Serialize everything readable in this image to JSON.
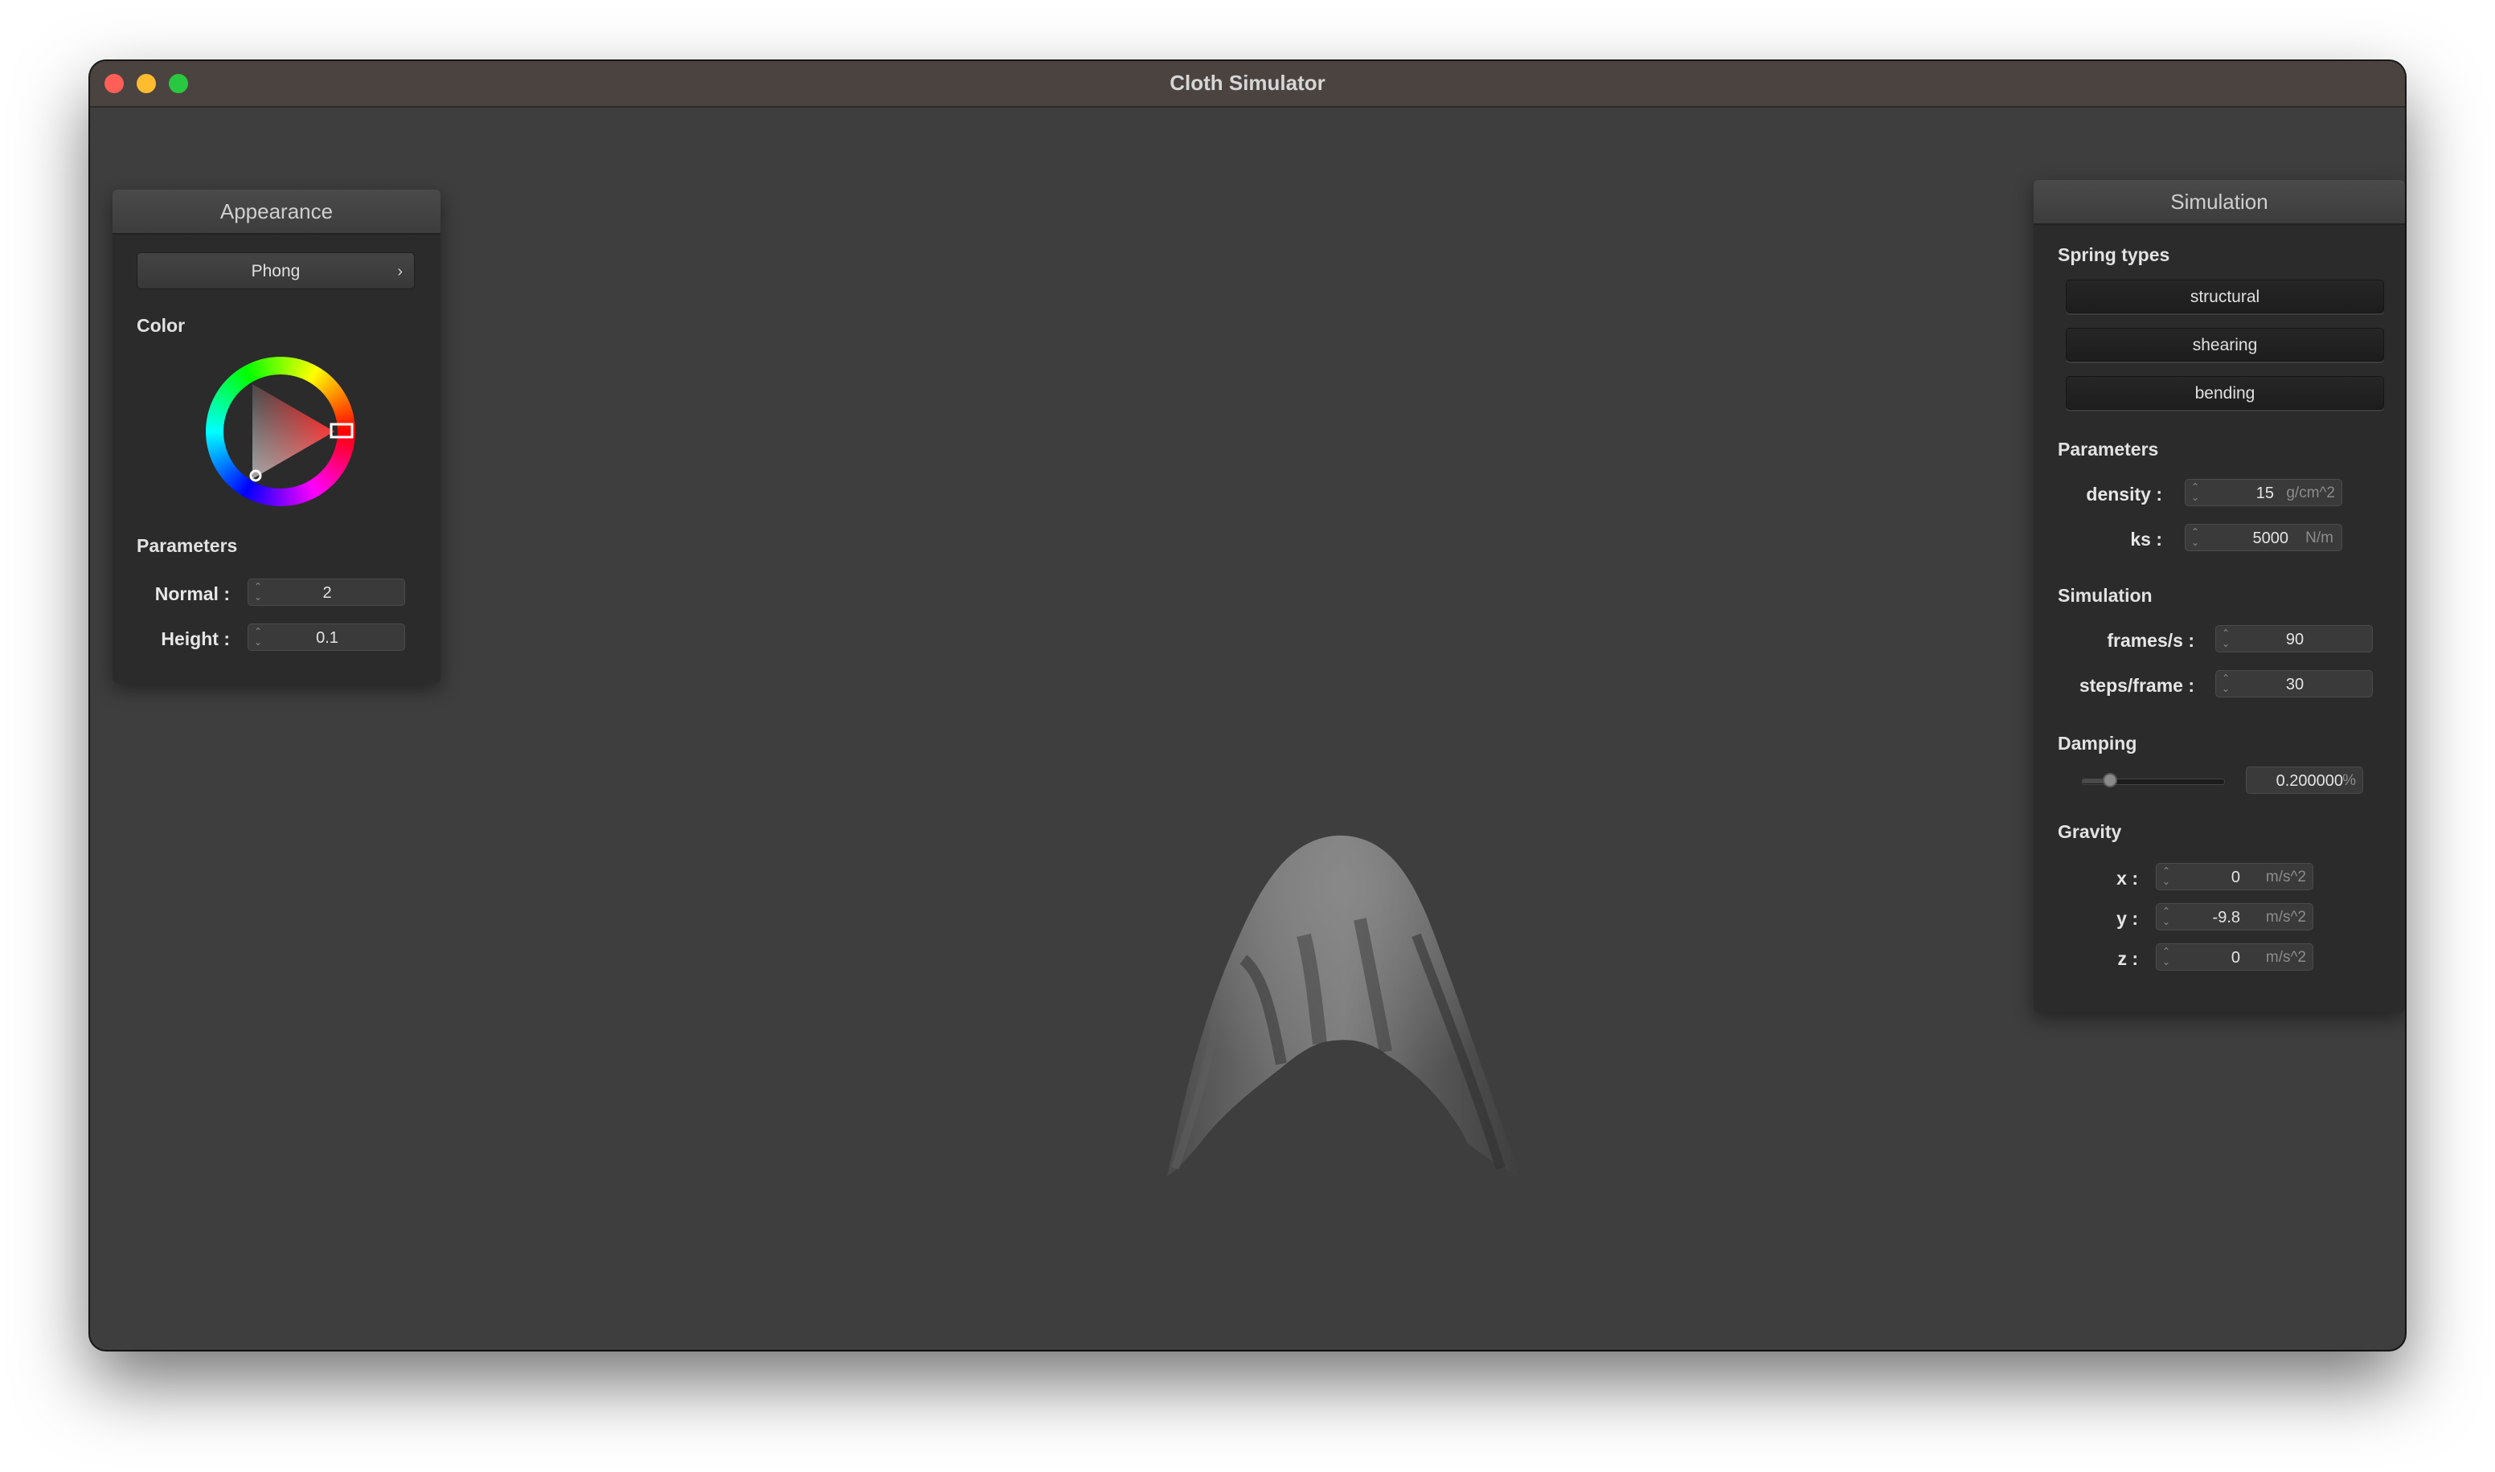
{
  "window": {
    "title": "Cloth Simulator",
    "traffic_lights": [
      "close",
      "minimize",
      "zoom"
    ]
  },
  "appearance": {
    "header": "Appearance",
    "shader_select": "Phong",
    "color_label": "Color",
    "color_value": "#ff1a1a",
    "parameters_label": "Parameters",
    "normal_label": "Normal :",
    "normal_value": "2",
    "height_label": "Height :",
    "height_value": "0.1"
  },
  "simulation": {
    "header": "Simulation",
    "spring_types_label": "Spring types",
    "spring_types": [
      "structural",
      "shearing",
      "bending"
    ],
    "parameters_label": "Parameters",
    "density_label": "density :",
    "density_value": "15",
    "density_unit": "g/cm^2",
    "ks_label": "ks :",
    "ks_value": "5000",
    "ks_unit": "N/m",
    "simulation_label": "Simulation",
    "fps_label": "frames/s :",
    "fps_value": "90",
    "steps_label": "steps/frame :",
    "steps_value": "30",
    "damping_label": "Damping",
    "damping_value": "0.200000",
    "damping_unit": "%",
    "damping_slider_fraction": 0.2,
    "gravity_label": "Gravity",
    "gravity_x_label": "x :",
    "gravity_x_value": "0",
    "gravity_y_label": "y :",
    "gravity_y_value": "-9.8",
    "gravity_z_label": "z :",
    "gravity_z_value": "0",
    "gravity_unit": "m/s^2"
  }
}
